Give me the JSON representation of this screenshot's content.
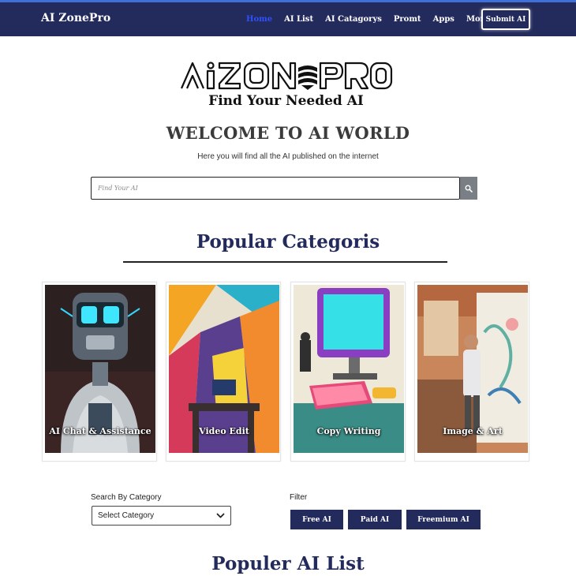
{
  "brand": "AI ZonePro",
  "nav": {
    "items": [
      "Home",
      "AI List",
      "AI Catagorys",
      "Promt",
      "Apps",
      "More"
    ],
    "submit": "Submit AI"
  },
  "hero": {
    "logo_text": "AIZONPRO",
    "tagline": "Find Your Needed AI",
    "welcome": "WELCOME TO AI WORLD",
    "subtitle": "Here you will find all the AI published on the internet"
  },
  "search": {
    "placeholder": "Find Your AI"
  },
  "categories": {
    "title": "Popular Categoris",
    "cards": [
      {
        "label": "AI Chat & Assistance"
      },
      {
        "label": "Video Edit"
      },
      {
        "label": "Copy Writing"
      },
      {
        "label": "Image & Art"
      }
    ]
  },
  "filters": {
    "category_label": "Search By Category",
    "select_value": "Select Category",
    "filter_label": "Filter",
    "buttons": [
      "Free AI",
      "Paid AI",
      "Freemium AI"
    ]
  },
  "list": {
    "title": "Populer AI List"
  },
  "colors": {
    "navy": "#232a5c",
    "active_link": "#2f50ff",
    "accent_top": "#3f6fd8",
    "search_button": "#7a7f86"
  },
  "icons": {
    "search": "search-icon",
    "dropdown": "chevron-down-icon"
  }
}
